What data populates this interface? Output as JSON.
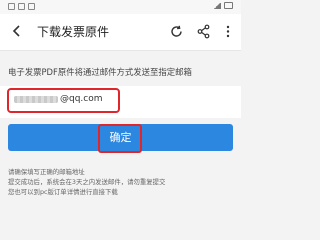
{
  "app_bar": {
    "title": "下载发票原件",
    "icons": [
      "back-icon",
      "refresh-icon",
      "share-icon",
      "more-icon"
    ]
  },
  "instruction": "电子发票PDF原件将通过邮件方式发送至指定邮箱",
  "email": {
    "value_visible_suffix": "@qq.com"
  },
  "confirm_button": {
    "label": "确定"
  },
  "notes": [
    "请确保填写正确的邮箱地址",
    "提交成功后，系统会在3天之内发送邮件，请勿重复提交",
    "您也可以到pc版订单详情进行直接下载"
  ],
  "colors": {
    "accent": "#2b87e0",
    "highlight_red": "#e1262b"
  }
}
